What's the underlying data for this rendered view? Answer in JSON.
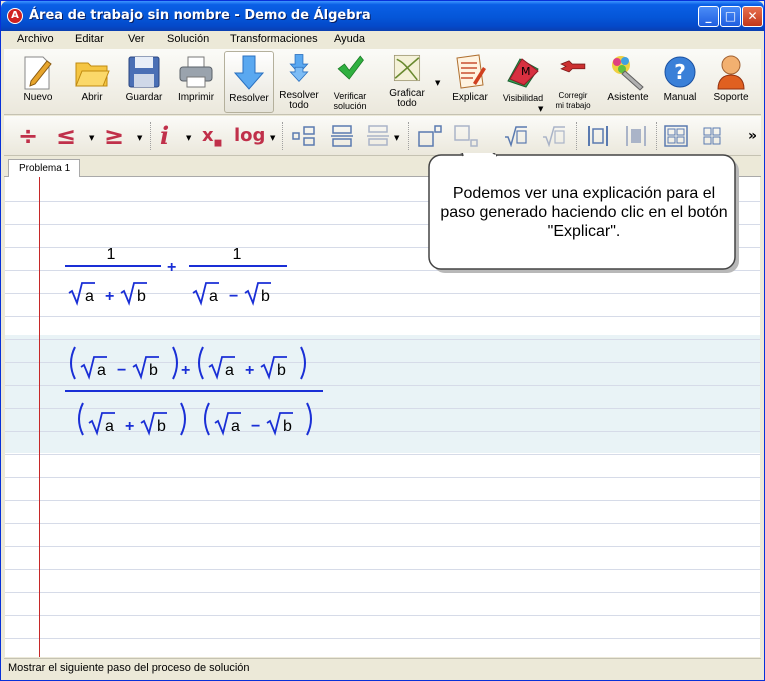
{
  "window": {
    "title": "Área de trabajo sin nombre - Demo de Álgebra",
    "app_icon": "app-logo-icon",
    "controls": [
      "minimize-icon",
      "maximize-icon",
      "close-icon"
    ]
  },
  "menu": [
    "Archivo",
    "Editar",
    "Ver",
    "Solución",
    "Transformaciones",
    "Ayuda"
  ],
  "toolbar": {
    "nuevo": "Nuevo",
    "abrir": "Abrir",
    "guardar": "Guardar",
    "imprimir": "Imprimir",
    "resolver": "Resolver",
    "resolver_todo_1": "Resolver",
    "resolver_todo_2": "todo",
    "verificar_1": "Verificar",
    "verificar_2": "solución",
    "graficar_1": "Graficar",
    "graficar_2": "todo",
    "explicar": "Explicar",
    "visibilidad": "Visibilidad",
    "corregir_1": "Corregir",
    "corregir_2": "mi trabajo",
    "asistente": "Asistente",
    "manual": "Manual",
    "soporte": "Soporte",
    "visibilidad_badge": "M",
    "manual_badge": "?"
  },
  "format_toolbar": {
    "divide": "÷",
    "leq": "≤",
    "geq": "≥",
    "italic_i": "i",
    "subscript_x": "x",
    "log": "log",
    "more": "»"
  },
  "tabs": [
    "Problema 1"
  ],
  "expressions": {
    "one": "1",
    "a": "a",
    "b": "b",
    "plus": "+",
    "minus": "−"
  },
  "callout": {
    "text": "Podemos ver una explicación para el paso generado haciendo clic en el botón \"Explicar\"."
  },
  "status": "Mostrar el siguiente paso del proceso de solución",
  "colors": {
    "titlebar": "#0556d8",
    "expr_blue": "#1a2fd6",
    "margin_red": "#c62828",
    "toolbar_red": "#c0304a"
  }
}
